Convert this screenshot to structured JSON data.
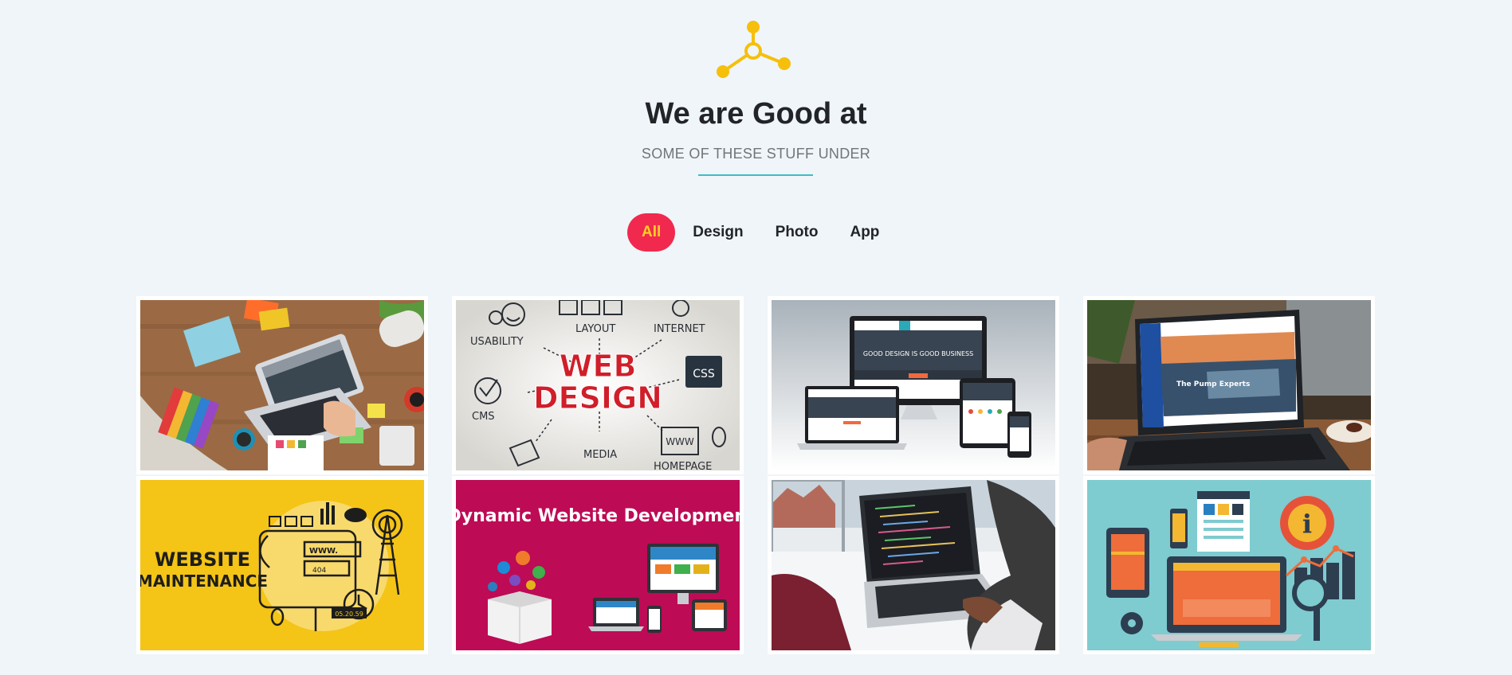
{
  "header": {
    "title": "We are Good at",
    "subtitle": "SOME OF THESE STUFF UNDER"
  },
  "filters": [
    {
      "label": "All",
      "active": true
    },
    {
      "label": "Design",
      "active": false
    },
    {
      "label": "Photo",
      "active": false
    },
    {
      "label": "App",
      "active": false
    }
  ],
  "colors": {
    "accent": "#f1294f",
    "active_text": "#ffd024",
    "divider": "#3fbcc2",
    "logo": "#f6bf0c"
  },
  "portfolio": [
    {
      "name": "workspace-desk-photo"
    },
    {
      "name": "web-design-doodle",
      "texts": [
        "USABILITY",
        "LAYOUT",
        "INTERNET",
        "WEB",
        "DESIGN",
        "CSS",
        "CMS",
        "MEDIA",
        "WWW",
        "HOMEPAGE"
      ]
    },
    {
      "name": "responsive-devices-mockup",
      "texts": [
        "GOOD DESIGN IS GOOD BUSINESS"
      ]
    },
    {
      "name": "laptop-website-photo",
      "texts": [
        "The Pump Experts"
      ]
    },
    {
      "name": "website-maintenance-illustration",
      "texts": [
        "WEBSITE",
        "MAINTENANCE",
        "WWW.",
        "404",
        "05.20.59"
      ]
    },
    {
      "name": "dynamic-website-development",
      "texts": [
        "Dynamic Website Development"
      ]
    },
    {
      "name": "coding-laptop-photo"
    },
    {
      "name": "flat-web-infographic"
    }
  ]
}
